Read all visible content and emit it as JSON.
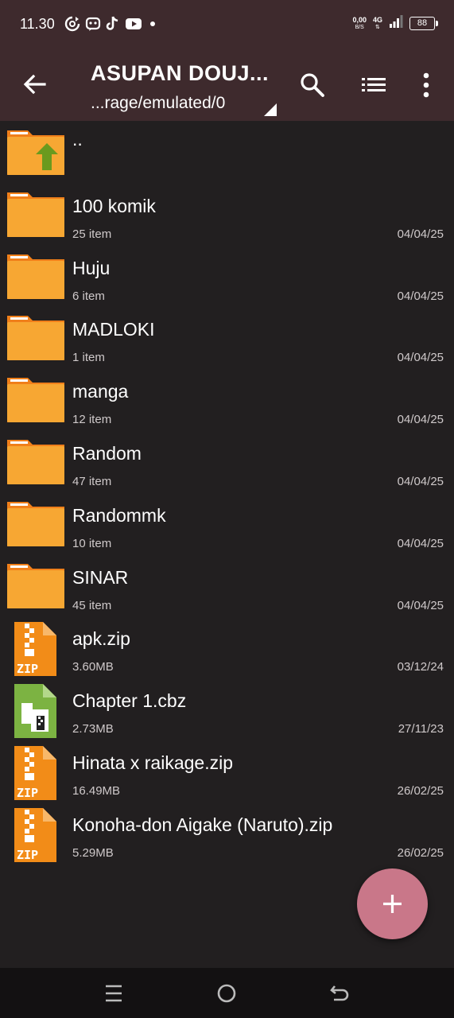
{
  "status_bar": {
    "time": "11.30",
    "net_speed": "0,00",
    "net_unit": "B/S",
    "network": "4G",
    "battery": "88",
    "icons": [
      "sync-icon",
      "messenger-icon",
      "tiktok-icon",
      "youtube-icon",
      "dot-icon"
    ]
  },
  "app_bar": {
    "title": "ASUPAN DOUJ...",
    "path": "...rage/emulated/0",
    "icons": [
      "back-arrow-icon",
      "search-icon",
      "list-view-icon",
      "more-vert-icon"
    ]
  },
  "files": [
    {
      "name": "..",
      "meta": "",
      "date": "",
      "icon": "folder-up-icon"
    },
    {
      "name": "100 komik",
      "meta": "25 item",
      "date": "04/04/25",
      "icon": "folder-icon"
    },
    {
      "name": "Huju",
      "meta": "6 item",
      "date": "04/04/25",
      "icon": "folder-icon"
    },
    {
      "name": "MADLOKI",
      "meta": "1 item",
      "date": "04/04/25",
      "icon": "folder-icon"
    },
    {
      "name": "manga",
      "meta": "12 item",
      "date": "04/04/25",
      "icon": "folder-icon"
    },
    {
      "name": "Random",
      "meta": "47 item",
      "date": "04/04/25",
      "icon": "folder-icon"
    },
    {
      "name": "Randommk",
      "meta": "10 item",
      "date": "04/04/25",
      "icon": "folder-icon"
    },
    {
      "name": "SINAR",
      "meta": "45 item",
      "date": "04/04/25",
      "icon": "folder-icon"
    },
    {
      "name": "apk.zip",
      "meta": "3.60MB",
      "date": "03/12/24",
      "icon": "zip-file-icon"
    },
    {
      "name": "Chapter 1.cbz",
      "meta": "2.73MB",
      "date": "27/11/23",
      "icon": "comic-archive-icon"
    },
    {
      "name": "Hinata x raikage.zip",
      "meta": "16.49MB",
      "date": "26/02/25",
      "icon": "zip-file-icon"
    },
    {
      "name": "Konoha-don Aigake (Naruto).zip",
      "meta": "5.29MB",
      "date": "26/02/25",
      "icon": "zip-file-icon"
    }
  ],
  "zip_label": "ZIP",
  "fab": {
    "icon": "plus-icon"
  },
  "nav_bar": {
    "icons": [
      "menu-icon",
      "home-circle-icon",
      "back-icon"
    ]
  },
  "colors": {
    "app_bar": "#3e2a2d",
    "background": "#221f20",
    "folder": "#f7a733",
    "folder_tab": "#f07f1a",
    "zip": "#f28c18",
    "cbz": "#7cb342",
    "fab": "#c97789"
  }
}
